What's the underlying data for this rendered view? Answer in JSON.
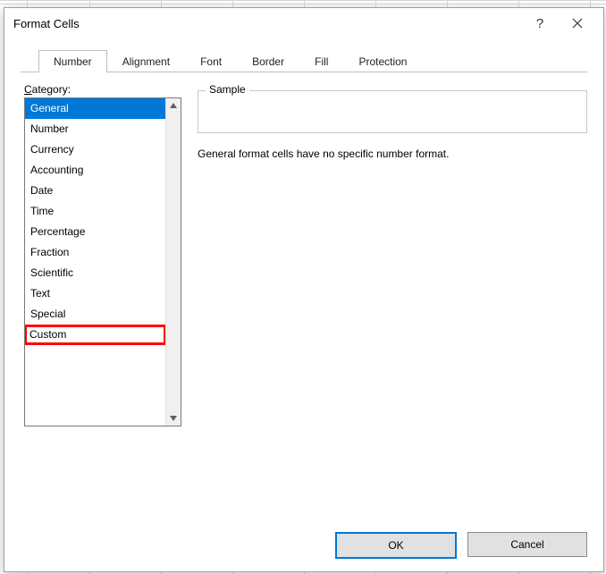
{
  "dialog": {
    "title": "Format Cells",
    "help_tooltip": "?",
    "close_tooltip": "Close"
  },
  "tabs": [
    {
      "label": "Number",
      "active": true
    },
    {
      "label": "Alignment",
      "active": false
    },
    {
      "label": "Font",
      "active": false
    },
    {
      "label": "Border",
      "active": false
    },
    {
      "label": "Fill",
      "active": false
    },
    {
      "label": "Protection",
      "active": false
    }
  ],
  "category": {
    "label_prefix": "C",
    "label_rest": "ategory:",
    "items": [
      {
        "label": "General",
        "selected": true,
        "highlighted": false
      },
      {
        "label": "Number",
        "selected": false,
        "highlighted": false
      },
      {
        "label": "Currency",
        "selected": false,
        "highlighted": false
      },
      {
        "label": "Accounting",
        "selected": false,
        "highlighted": false
      },
      {
        "label": "Date",
        "selected": false,
        "highlighted": false
      },
      {
        "label": "Time",
        "selected": false,
        "highlighted": false
      },
      {
        "label": "Percentage",
        "selected": false,
        "highlighted": false
      },
      {
        "label": "Fraction",
        "selected": false,
        "highlighted": false
      },
      {
        "label": "Scientific",
        "selected": false,
        "highlighted": false
      },
      {
        "label": "Text",
        "selected": false,
        "highlighted": false
      },
      {
        "label": "Special",
        "selected": false,
        "highlighted": false
      },
      {
        "label": "Custom",
        "selected": false,
        "highlighted": true
      }
    ]
  },
  "sample": {
    "label": "Sample",
    "value": ""
  },
  "description": "General format cells have no specific number format.",
  "buttons": {
    "ok": "OK",
    "cancel": "Cancel"
  }
}
